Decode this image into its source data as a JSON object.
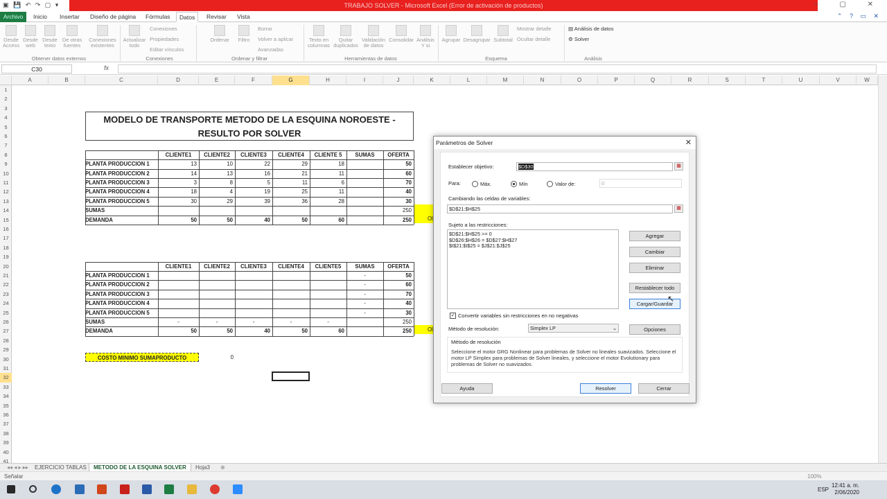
{
  "window": {
    "title": "TRABAJO SOLVER - Microsoft Excel (Error de activación de productos)"
  },
  "tabs": [
    "Archivo",
    "Inicio",
    "Insertar",
    "Diseño de página",
    "Fórmulas",
    "Datos",
    "Revisar",
    "Vista"
  ],
  "ribbon": {
    "desde_acceso": "Desde Access",
    "desde_web": "Desde web",
    "desde_texto": "Desde texto",
    "otras_fuentes": "De otras fuentes",
    "conexiones_existentes": "Conexiones existentes",
    "actualizar_todo": "Actualizar todo",
    "conexiones": "Conexiones",
    "propiedades": "Propiedades",
    "editar_vinculos": "Editar vínculos",
    "ordenar": "Ordenar",
    "filtro": "Filtro",
    "borrar": "Borrar",
    "volver_aplicar": "Volver a aplicar",
    "avanzadas": "Avanzadas",
    "texto_columnas": "Texto en columnas",
    "quitar_duplicados": "Quitar duplicados",
    "validacion": "Validación de datos",
    "consolidar": "Consolidar",
    "analisis_ysi": "Análisis Y si",
    "agrupar": "Agrupar",
    "desagrupar": "Desagrupar",
    "subtotal": "Subtotal",
    "mostrar_detalle": "Mostrar detalle",
    "ocultar_detalle": "Ocultar detalle",
    "analisis_datos": "Análisis de datos",
    "solver": "Solver",
    "g_obtener": "Obtener datos externos",
    "g_conexiones": "Conexiones",
    "g_ordenar": "Ordenar y filtrar",
    "g_herramientas": "Herramientas de datos",
    "g_esquema": "Esquema",
    "g_analisis": "Análisis"
  },
  "namebox": "C30",
  "fx": "fx",
  "columns": [
    "A",
    "B",
    "C",
    "D",
    "E",
    "F",
    "G",
    "H",
    "I",
    "J",
    "K",
    "L",
    "M",
    "N",
    "O",
    "P",
    "Q",
    "R",
    "S",
    "T",
    "U",
    "V",
    "W"
  ],
  "rows": [
    "1",
    "2",
    "3",
    "4",
    "5",
    "6",
    "7",
    "8",
    "9",
    "10",
    "11",
    "12",
    "13",
    "14",
    "15",
    "16",
    "17",
    "18",
    "19",
    "20",
    "21",
    "22",
    "23",
    "24",
    "25",
    "26",
    "27",
    "28",
    "29",
    "30",
    "31",
    "32",
    "33",
    "34",
    "35",
    "36",
    "37",
    "38",
    "39",
    "40",
    "41"
  ],
  "sheet": {
    "title_line1": "MODELO DE TRANSPORTE METODO DE LA ESQUINA NOROESTE -",
    "title_line2": "RESULTO POR SOLVER",
    "headers1": [
      "CLIENTE1",
      "CLIENTE2",
      "CLIENTE3",
      "CLIENTE4",
      "CLIENTE 5",
      "SUMAS",
      "OFERTA"
    ],
    "headers2": [
      "CLIENTE1",
      "CLIENTE2",
      "CLIENTE3",
      "CLIENTE4",
      "CLIENTE5",
      "SUMAS",
      "OFERTA"
    ],
    "plants": [
      "PLANTA PRODUCCION 1",
      "PLANTA PRODUCCION 2",
      "PLANTA PRODUCCION 3",
      "PLANTA PRODUCCION 4",
      "PLANTA PRODUCCION 5"
    ],
    "costs": [
      [
        "13",
        "10",
        "22",
        "29",
        "18",
        "",
        "50"
      ],
      [
        "14",
        "13",
        "16",
        "21",
        "11",
        "",
        "60"
      ],
      [
        "3",
        "8",
        "5",
        "11",
        "6",
        "",
        "70"
      ],
      [
        "18",
        "4",
        "19",
        "25",
        "11",
        "",
        "40"
      ],
      [
        "30",
        "29",
        "39",
        "36",
        "28",
        "",
        "30"
      ]
    ],
    "sumas_label": "SUMAS",
    "demanda_label": "DEMANDA",
    "sumas1": [
      "",
      "",
      "",
      "",
      "",
      "",
      "250"
    ],
    "demanda1": [
      "50",
      "50",
      "40",
      "50",
      "60",
      "",
      "250"
    ],
    "alloc_sumas": [
      "-",
      "-",
      "-",
      "-",
      "-"
    ],
    "alloc_oferta": [
      "50",
      "60",
      "70",
      "40",
      "30"
    ],
    "sumas2": [
      "-",
      "-",
      "-",
      "-",
      "-",
      "",
      "250"
    ],
    "demanda2": [
      "50",
      "50",
      "40",
      "50",
      "60",
      "",
      "250"
    ],
    "k_cut1": "Ol",
    "k_cut2": "Ol",
    "costo_label": "COSTO MINIMO SUMAPRODUCTO",
    "costo_value": "0"
  },
  "sheet_tabs": [
    "EJERCICIO TABLAS",
    "METODO DE LA ESQUINA SOLVER",
    "Hoja3"
  ],
  "status": {
    "left": "Señalar",
    "zoom": "100%"
  },
  "taskbar": {
    "lang": "ESP",
    "time": "12:41 a. m.",
    "date": "2/06/2020"
  },
  "dialog": {
    "title": "Parámetros de Solver",
    "objetivo_label": "Establecer objetivo:",
    "objetivo_value": "$D$30",
    "para_label": "Para:",
    "max": "Máx.",
    "min": "Mín",
    "valor": "Valor de:",
    "valor_value": "0",
    "cambiando_label": "Cambiando las celdas de variables:",
    "cambiando_value": "$D$21:$H$25",
    "sujeto_label": "Sujeto a las restricciones:",
    "restricciones": [
      "$D$21:$H$25 >= 0",
      "$D$26:$H$26 = $D$27:$H$27",
      "$I$21:$I$25 = $J$21:$J$25"
    ],
    "btn_agregar": "Agregar",
    "btn_cambiar": "Cambiar",
    "btn_eliminar": "Eliminar",
    "btn_restablecer": "Restablecer todo",
    "btn_cargar": "Cargar/Guardar",
    "convertir": "Convertir variables sin restricciones en no negativas",
    "metodo_label": "Método de resolución:",
    "metodo_value": "Simplex LP",
    "btn_opciones": "Opciones",
    "metodo_box_title": "Método de resolución",
    "metodo_text": "Seleccione el motor GRG Nonlinear para problemas de Solver no lineales suavizados. Seleccione el motor LP Simplex para problemas de Solver lineales, y seleccione el motor Evolutionary para problemas de Solver no suavizados.",
    "btn_ayuda": "Ayuda",
    "btn_resolver": "Resolver",
    "btn_cerrar": "Cerrar"
  }
}
